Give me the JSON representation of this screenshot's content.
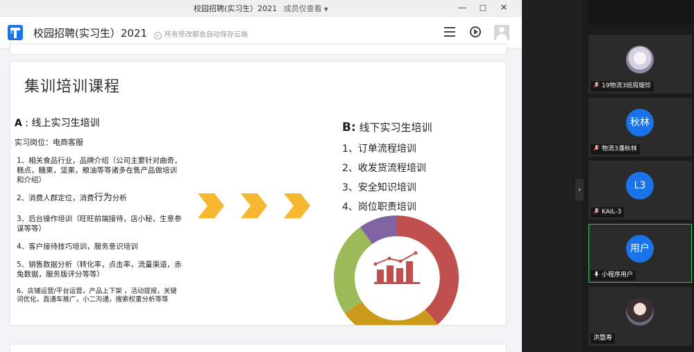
{
  "window": {
    "title": "校园招聘(实习生）2021",
    "members_view": "成员仅查看",
    "minimize": "—",
    "maximize": "☐",
    "close": "✕"
  },
  "doc": {
    "name": "校园招聘(实习生）2021",
    "autosave": "所有修改都会自动保存云端"
  },
  "slide": {
    "title": "集训培训课程",
    "section_a": {
      "prefix": "A",
      "label": "线上实习生培训",
      "post": "实习岗位：电商客服",
      "items": [
        "1、相关食品行业，品牌介绍（公司主要针对曲奇，糕点，糖果，坚果，粮油等等诸多在售产品做培训和介绍）",
        "3、后台操作培训（旺旺前端接待，店小秘，生意参谋等等）",
        "4、客户接待技巧培训，服务意识培训",
        "5、销售数据分析（转化率，点击率，流量渠道，赤兔数据，服务版评分等等）",
        "6、店铺运营/平台运营，产品上下架 ，活动提报，关键词优化，直通车推广，小二沟通，搜索权重分析等等"
      ],
      "item2": {
        "a": "2、消费人群定位，消费",
        "b": "行为",
        "c": "分析"
      }
    },
    "section_b": {
      "prefix": "B:",
      "label": "线下实习生培训",
      "items": [
        "1、订单流程培训",
        "2、收发货流程培训",
        "3、安全知识培训",
        "4、岗位职责培训"
      ]
    },
    "arrow_color": "#f7b731",
    "donut_colors": [
      "#c0504d",
      "#cc9a1a",
      "#9bbb59",
      "#8064a2"
    ]
  },
  "participants": [
    {
      "name": "19物流3班周璇珍",
      "avatar": "",
      "muted": true
    },
    {
      "name": "物流3潘秋林",
      "avatar": "秋林",
      "muted": true
    },
    {
      "name": "KAIL-3",
      "avatar": "L3",
      "muted": true
    },
    {
      "name": "小程序用户",
      "avatar": "用户",
      "muted": false
    },
    {
      "name": "洪暨寿",
      "avatar": "",
      "muted": false
    }
  ],
  "colors": {
    "accent": "#1a73e8",
    "active_border": "#3ac16b"
  }
}
